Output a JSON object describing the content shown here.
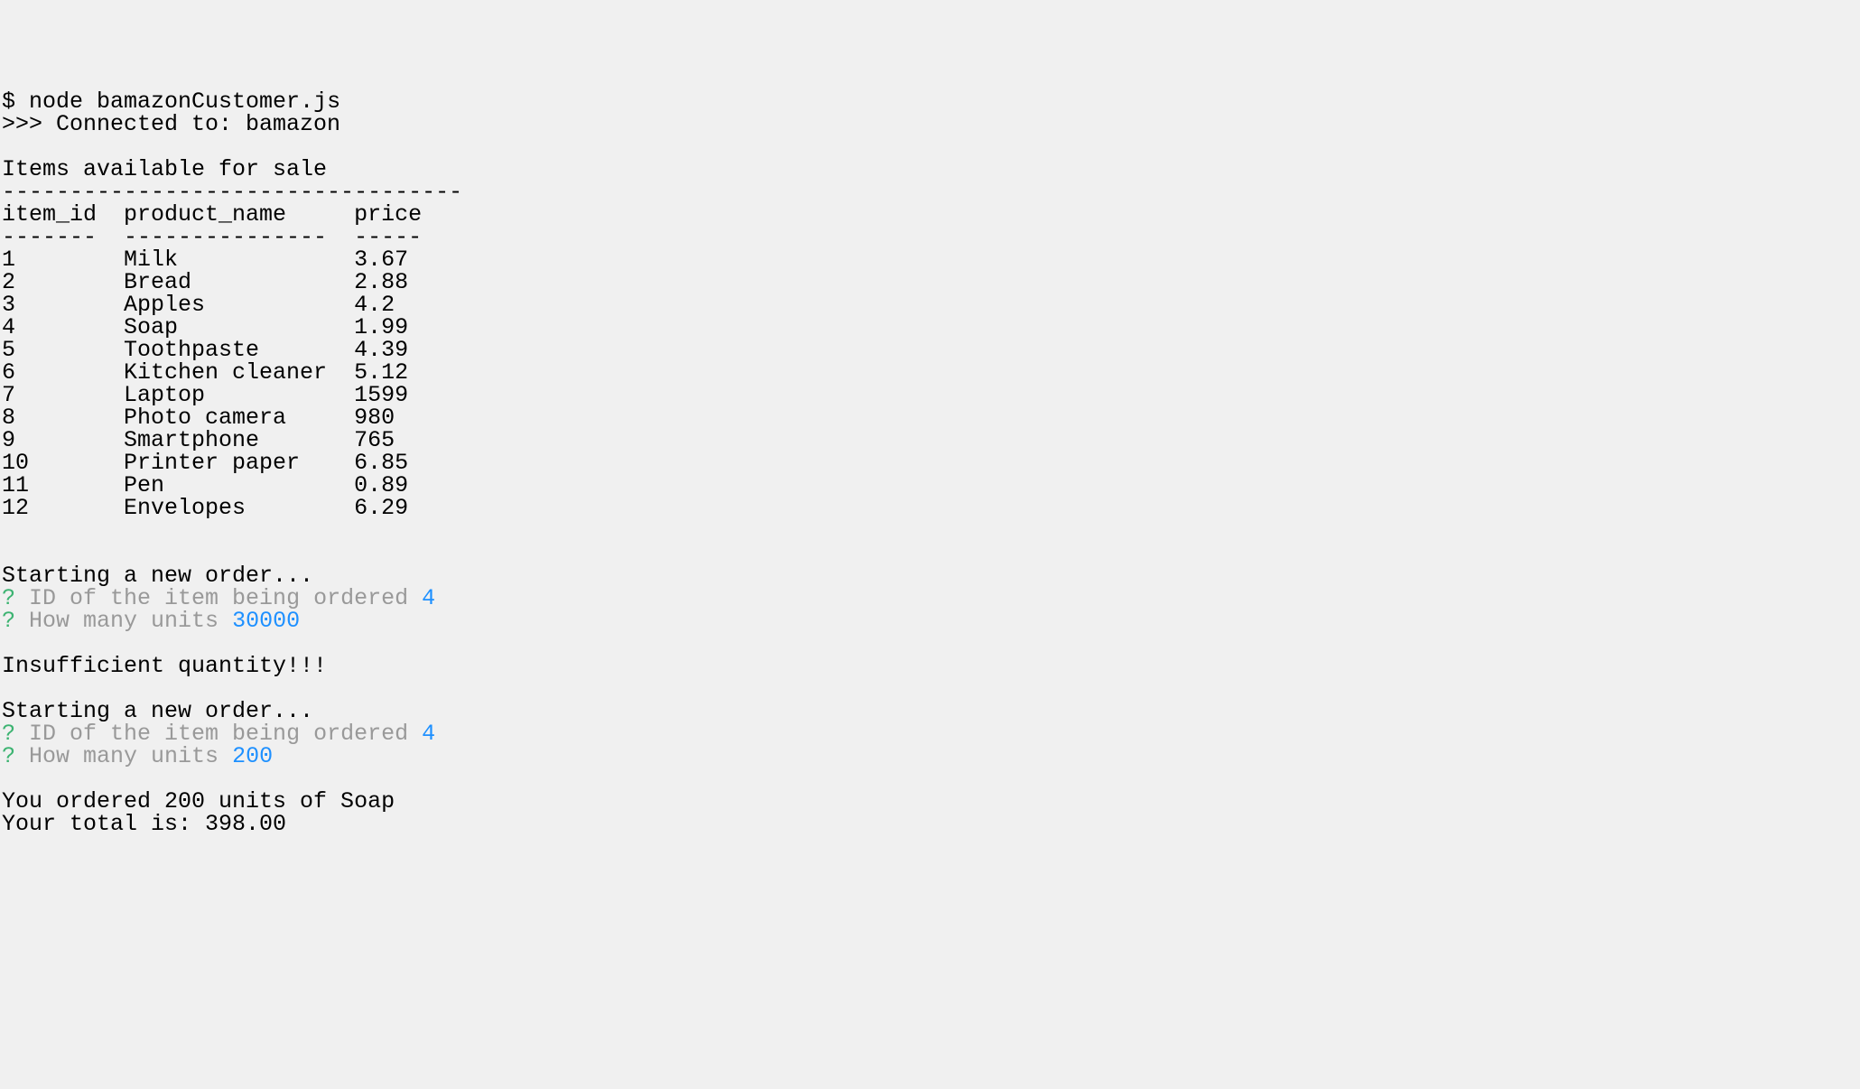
{
  "command": {
    "prompt": "$ ",
    "text": "node bamazonCustomer.js"
  },
  "connected": ">>> Connected to: bamazon",
  "blank": "",
  "header": "Items available for sale",
  "thick_rule": "----------------------------------",
  "columns_line": "item_id  product_name     price",
  "column_rule": "-------  ---------------  -----",
  "rows": [
    "1        Milk             3.67",
    "2        Bread            2.88",
    "3        Apples           4.2",
    "4        Soap             1.99",
    "5        Toothpaste       4.39",
    "6        Kitchen cleaner  5.12",
    "7        Laptop           1599",
    "8        Photo camera     980",
    "9        Smartphone       765",
    "10       Printer paper    6.85",
    "11       Pen              0.89",
    "12       Envelopes        6.29"
  ],
  "order1": {
    "start": "Starting a new order...",
    "q1": {
      "mark": "?",
      "label": " ID of the item being ordered ",
      "value": "4"
    },
    "q2": {
      "mark": "?",
      "label": " How many units ",
      "value": "30000"
    }
  },
  "insufficient": "Insufficient quantity!!!",
  "order2": {
    "start": "Starting a new order...",
    "q1": {
      "mark": "?",
      "label": " ID of the item being ordered ",
      "value": "4"
    },
    "q2": {
      "mark": "?",
      "label": " How many units ",
      "value": "200"
    }
  },
  "result": {
    "ordered": "You ordered 200 units of Soap",
    "total": "Your total is: 398.00"
  }
}
